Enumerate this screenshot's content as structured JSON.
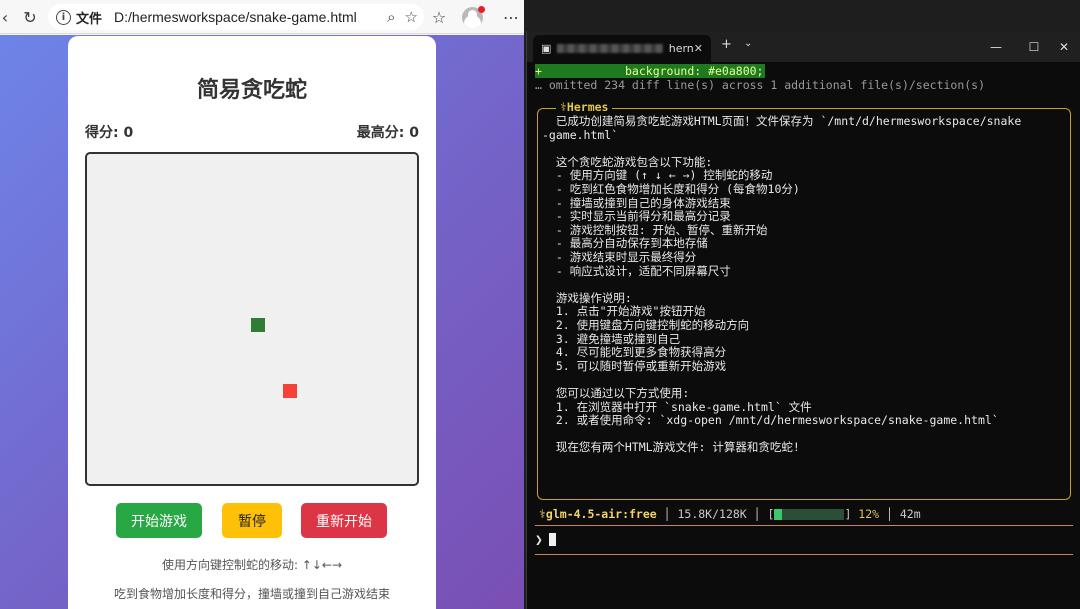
{
  "browser": {
    "address": {
      "scheme": "文件",
      "url": "D:/hermesworkspace/snake-game.html"
    }
  },
  "game": {
    "title": "简易贪吃蛇",
    "score_label": "得分: 0",
    "high_score_label": "最高分: 0",
    "buttons": {
      "start": "开始游戏",
      "pause": "暂停",
      "restart": "重新开始"
    },
    "hint_controls": "使用方向键控制蛇的移动: ↑↓←→",
    "hint_rules": "吃到食物增加长度和得分，撞墙或撞到自己游戏结束",
    "colors": {
      "snake": "#2e7d32",
      "food": "#f44336"
    }
  },
  "terminal": {
    "tab_title": "hern",
    "diff_line": "+            background: #e0a800;",
    "omitted_line": "… omitted 234 diff line(s) across 1 additional file(s)/section(s)",
    "panel_title": "⚕Hermes",
    "lines": [
      "  已成功创建简易贪吃蛇游戏HTML页面！文件保存为 `/mnt/d/hermesworkspace/snake",
      "-game.html`",
      "",
      "  这个贪吃蛇游戏包含以下功能:",
      "  - 使用方向键 (↑ ↓ ← →) 控制蛇的移动",
      "  - 吃到红色食物增加长度和得分 (每食物10分)",
      "  - 撞墙或撞到自己的身体游戏结束",
      "  - 实时显示当前得分和最高分记录",
      "  - 游戏控制按钮: 开始、暂停、重新开始",
      "  - 最高分自动保存到本地存储",
      "  - 游戏结束时显示最终得分",
      "  - 响应式设计，适配不同屏幕尺寸",
      "",
      "  游戏操作说明:",
      "  1. 点击\"开始游戏\"按钮开始",
      "  2. 使用键盘方向键控制蛇的移动方向",
      "  3. 避免撞墙或撞到自己",
      "  4. 尽可能吃到更多食物获得高分",
      "  5. 可以随时暂停或重新开始游戏",
      "",
      "  您可以通过以下方式使用:",
      "  1. 在浏览器中打开 `snake-game.html` 文件",
      "  2. 或者使用命令: `xdg-open /mnt/d/hermesworkspace/snake-game.html`",
      "",
      "  现在您有两个HTML游戏文件: 计算器和贪吃蛇!"
    ],
    "status": {
      "model": "⚕glm-4.5-air:free",
      "tokens": "15.8K/128K",
      "context_percent": 12,
      "percent_label": "12%",
      "time": "42m"
    },
    "prompt": "❯"
  }
}
